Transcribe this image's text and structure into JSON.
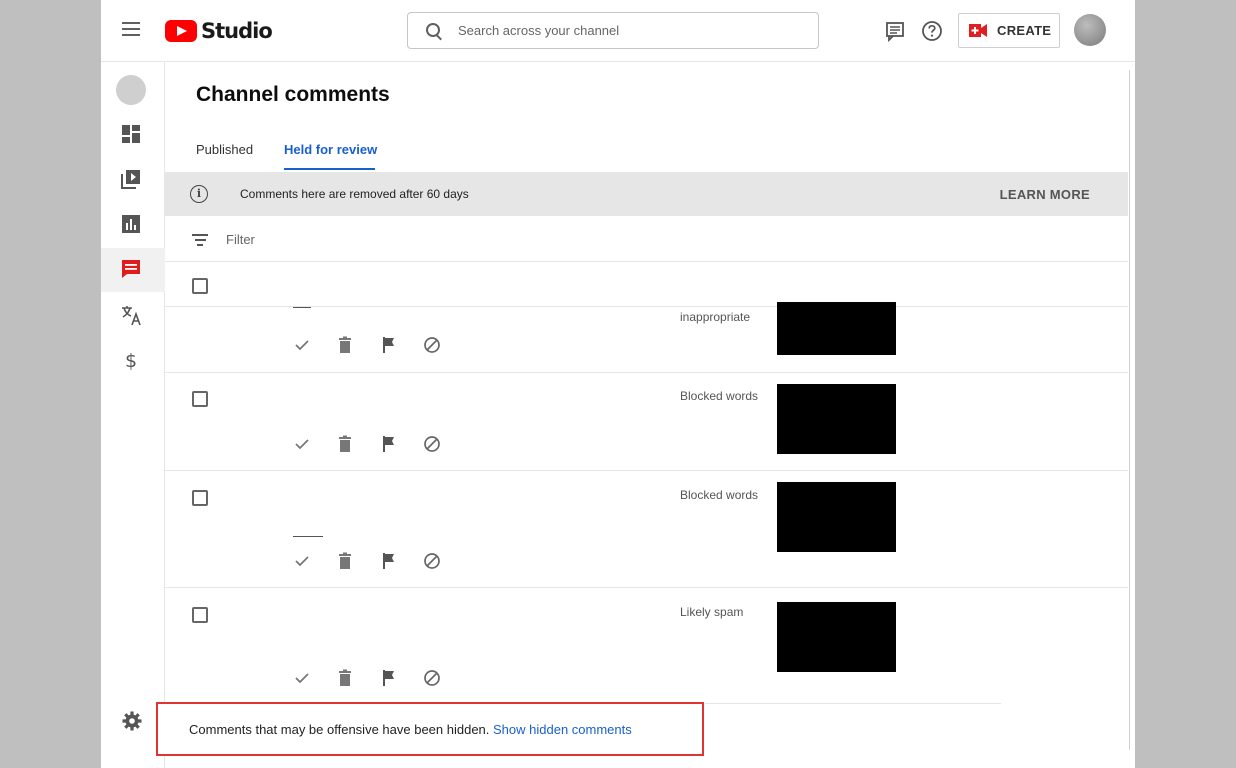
{
  "header": {
    "logo_text": "Studio",
    "search_placeholder": "Search across your channel",
    "create_label": "CREATE"
  },
  "sidebar": {
    "items": [
      {
        "icon": "dashboard-icon"
      },
      {
        "icon": "content-icon"
      },
      {
        "icon": "analytics-icon"
      },
      {
        "icon": "comments-icon",
        "active": true
      },
      {
        "icon": "translate-icon"
      },
      {
        "icon": "monetization-icon"
      }
    ],
    "settings_icon": "settings-icon"
  },
  "main": {
    "title": "Channel comments",
    "tabs": [
      {
        "label": "Published",
        "active": false
      },
      {
        "label": "Held for review",
        "active": true
      }
    ],
    "banner": {
      "text": "Comments here are removed after 60 days",
      "action": "LEARN MORE"
    },
    "filter_placeholder": "Filter",
    "comments": [
      {
        "reason": "inappropriate"
      },
      {
        "reason": "Blocked words"
      },
      {
        "reason": "Blocked words"
      },
      {
        "reason": "Likely spam"
      }
    ],
    "hidden_notice": {
      "text": "Comments that may be offensive have been hidden.",
      "link": "Show hidden comments"
    }
  },
  "colors": {
    "accent": "#1a5fd0",
    "brand_red": "#ff0000",
    "highlight_border": "#e03333"
  }
}
